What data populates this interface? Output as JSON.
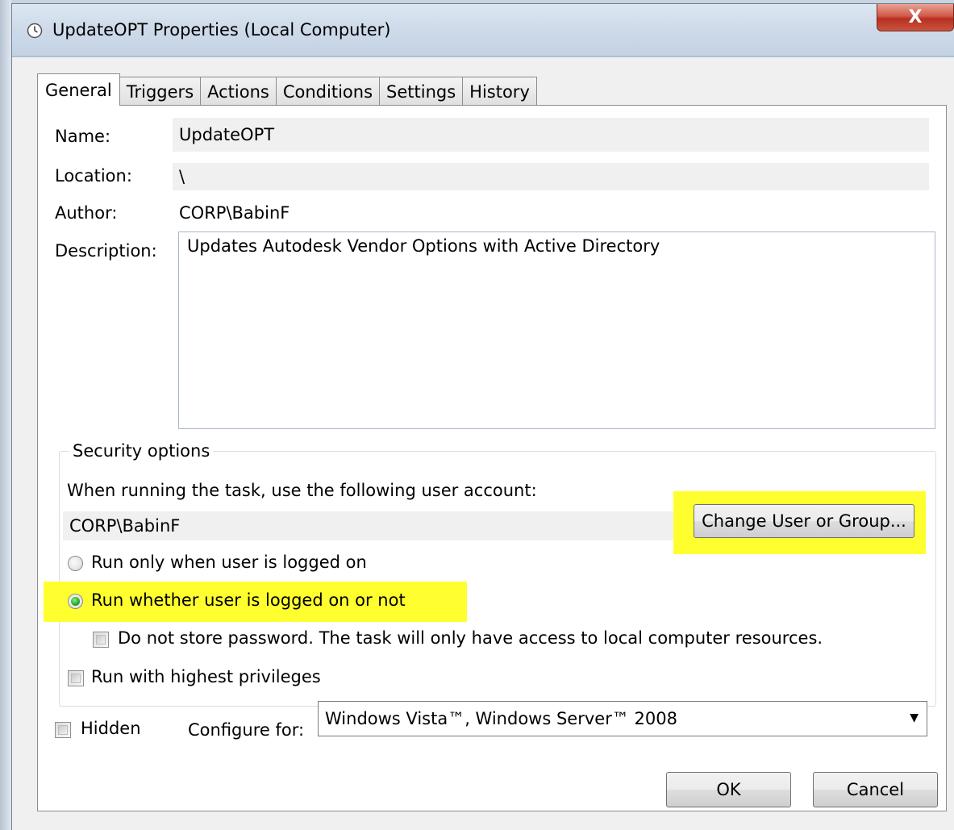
{
  "window": {
    "title": "UpdateOPT Properties (Local Computer)",
    "close_label": "X"
  },
  "tabs": [
    {
      "label": "General"
    },
    {
      "label": "Triggers"
    },
    {
      "label": "Actions"
    },
    {
      "label": "Conditions"
    },
    {
      "label": "Settings"
    },
    {
      "label": "History"
    }
  ],
  "active_tab": "General",
  "general": {
    "name_label": "Name:",
    "name_value": "UpdateOPT",
    "location_label": "Location:",
    "location_value": "\\",
    "author_label": "Author:",
    "author_value": "CORP\\BabinF",
    "description_label": "Description:",
    "description_value": "Updates Autodesk Vendor Options with Active Directory"
  },
  "security": {
    "legend": "Security options",
    "account_prompt": "When running the task, use the following user account:",
    "account_value": "CORP\\BabinF",
    "change_button": "Change User or Group...",
    "radio_logged_on": "Run only when user is logged on",
    "radio_whether": "Run whether user is logged on or not",
    "selected_option": "Run whether user is logged on or not",
    "no_store_password": "Do not store password.  The task will only have access to local computer resources.",
    "highest_privileges": "Run with highest privileges"
  },
  "bottom": {
    "hidden_label": "Hidden",
    "configure_label": "Configure for:",
    "configure_value": "Windows Vista™, Windows Server™ 2008"
  },
  "buttons": {
    "ok": "OK",
    "cancel": "Cancel"
  },
  "highlight_color": "#ffff30",
  "icons": {
    "title": "clock-icon",
    "dropdown": "chevron-down-icon"
  }
}
